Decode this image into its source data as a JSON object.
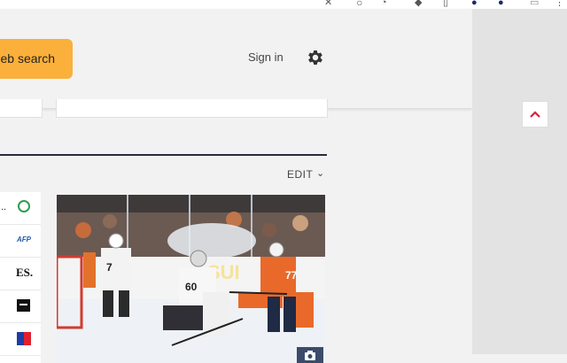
{
  "header": {
    "search_button_label": "eb search",
    "sign_in_label": "Sign in"
  },
  "feed": {
    "edit_label": "EDIT"
  },
  "sources": {
    "items": [
      {
        "text": "..",
        "kind": "ellipsis"
      },
      {
        "text": "AFP",
        "kind": "logo"
      },
      {
        "text": "ES.",
        "kind": "logo"
      },
      {
        "text": "",
        "kind": "logo-box"
      },
      {
        "text": "",
        "kind": "flag"
      }
    ]
  },
  "photo": {
    "subject": "hockey-game",
    "player_numbers": [
      "7",
      "60",
      "77"
    ]
  },
  "icons": [
    "close-icon",
    "settings-gear-icon",
    "chevron-down-icon",
    "chevron-up-icon",
    "camera-icon",
    "status-circle-icon"
  ],
  "colors": {
    "search_button": "#fbb03b",
    "rule": "#2b2b3d",
    "scroll_top_arrow": "#d6243c"
  }
}
